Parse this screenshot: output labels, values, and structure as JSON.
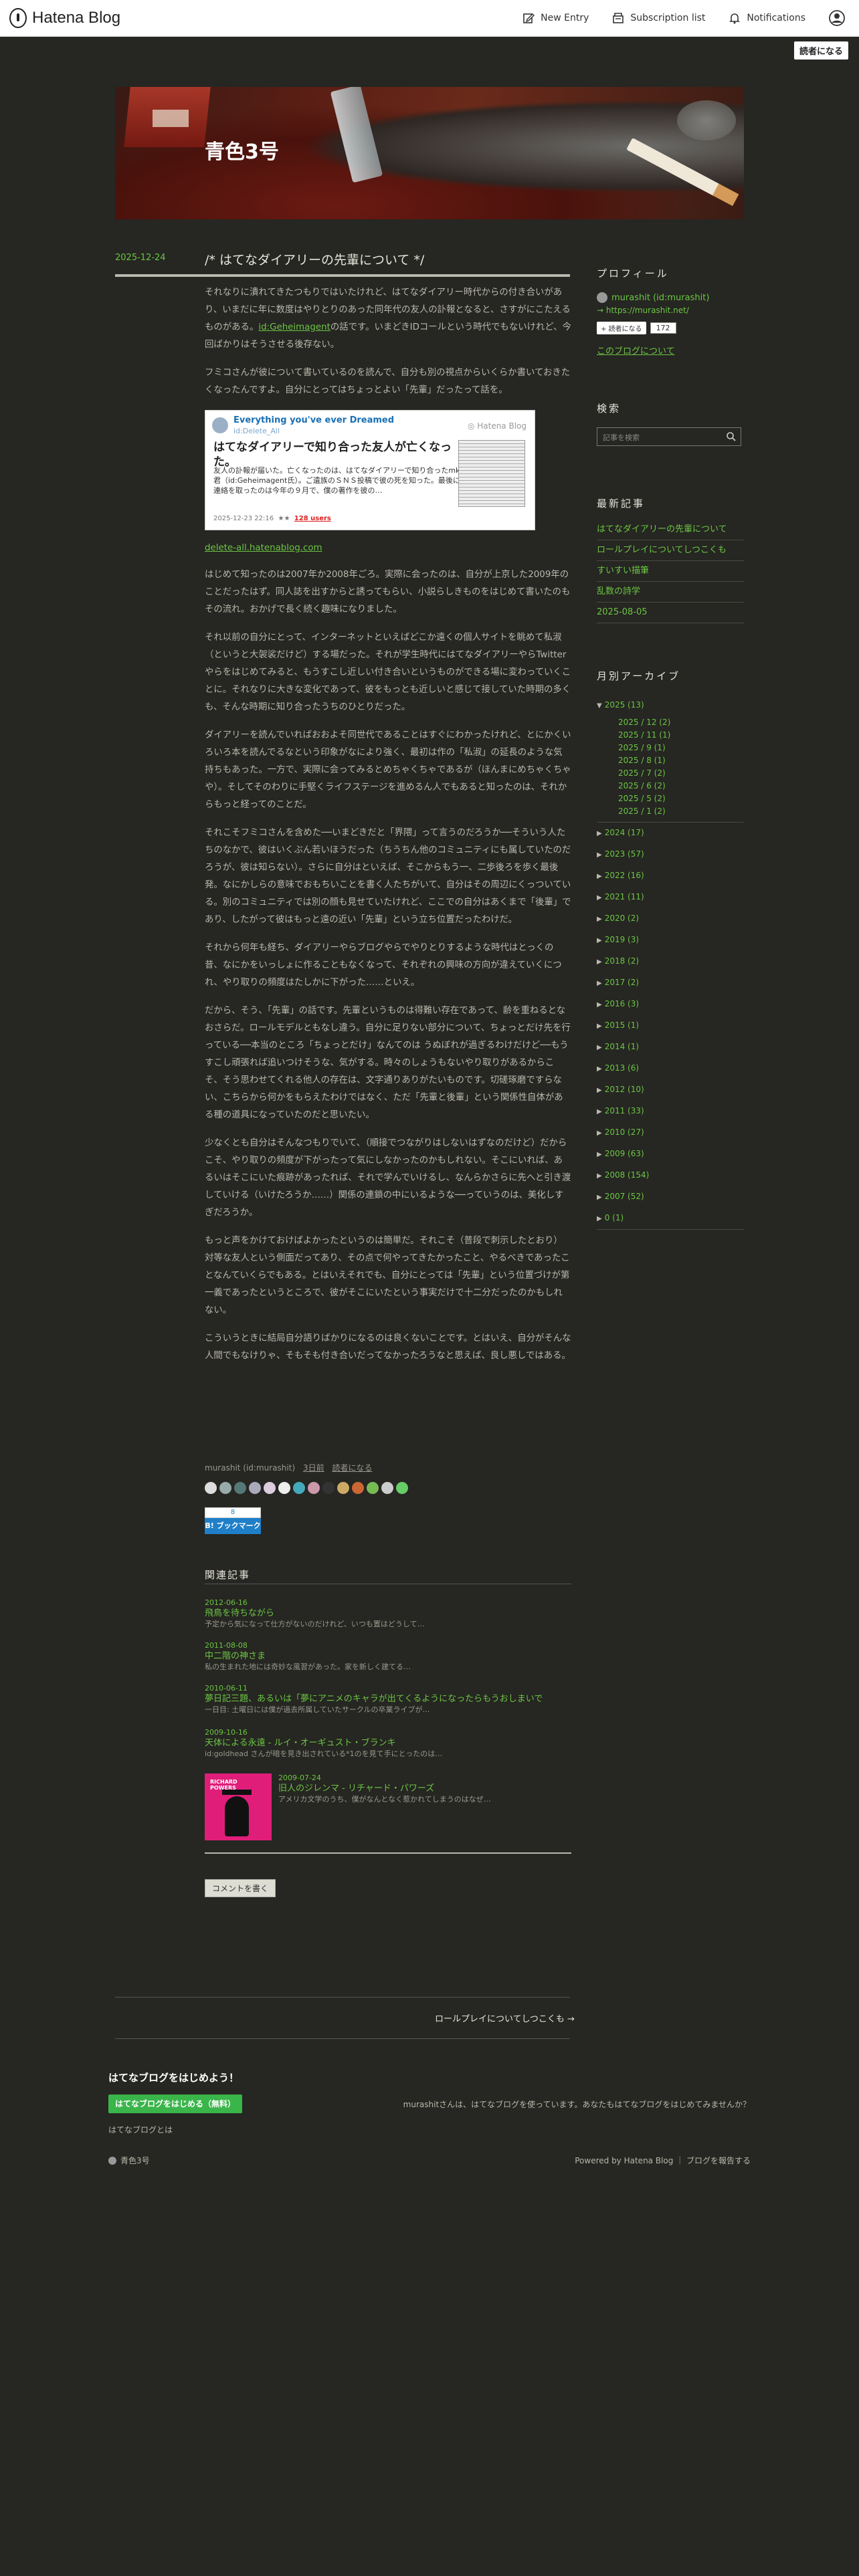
{
  "global_header": {
    "brand": "Hatena Blog",
    "new_entry": "New Entry",
    "subscription": "Subscription list",
    "notifications": "Notifications",
    "reader_button": "読者になる"
  },
  "blog": {
    "title": "青色3号"
  },
  "entry": {
    "date": "2025-12-24",
    "title": "/* はてなダイアリーの先輩について */",
    "paragraphs": [
      {
        "before": "それなりに潰れてきたつもりではいたけれど、はてなダイアリー時代からの付き合いがあり、いまだに年に数度はやりとりのあった同年代の友人の訃報となると、さすがにこたえるものがある。",
        "link": "id:Geheimagent",
        "after": "の話です。いまどきIDコールという時代でもないけれど、今回ばかりはそうさせる後存ない。"
      },
      {
        "before": "フミコさんが彼について書いているのを読んで、自分も別の視点からいくらか書いておきたくなったんですよ。自分にとってはちょっとよい「先輩」だったって話を。",
        "link": "",
        "after": ""
      }
    ],
    "embed": {
      "source": "Everything you've ever Dreamed",
      "source_id": "id:Delete_All",
      "brand": "Hatena Blog",
      "title": "はてなダイアリーで知り合った友人が亡くなった。",
      "excerpt": "友人の訃報が届いた。亡くなったのは、はてなダイアリーで知り合ったmk君（id:Geheimagent氏）。ご遺族のＳＮＳ投稿で彼の死を知った。最後に連絡を取ったのは今年の９月で、僕の著作を彼の…",
      "meta": "2025-12-23 22:16",
      "users": "128 users"
    },
    "embed_link": "delete-all.hatenablog.com",
    "paragraphs2": [
      "はじめて知ったのは2007年か2008年ごろ。実際に会ったのは、自分が上京した2009年のことだったはず。同人誌を出すからと誘ってもらい、小説らしきものをはじめて書いたのもその流れ。おかげで長く続く趣味になりました。",
      "それ以前の自分にとって、インターネットといえばどこか遠くの個人サイトを眺めて私淑（というと大袈裟だけど）する場だった。それが学生時代にはてなダイアリーやらTwitterやらをはじめてみると、もうすこし近しい付き合いというものができる場に変わっていくことに。それなりに大きな変化であって、彼をもっとも近しいと感じて接していた時期の多くも、そんな時期に知り合ったうちのひとりだった。",
      "ダイアリーを読んでいればおおよそ同世代であることはすぐにわかったけれど、とにかくいろいろ本を読んでるなという印象がなにより強く、最初は作の「私淑」の延長のような気持ちもあった。一方で、実際に会ってみるとめちゃくちゃであるが（ほんまにめちゃくちゃや）。そしてそのわりに手堅くライフステージを進めるん人でもあると知ったのは、それからもっと経ってのことだ。",
      "それこそフミコさんを含めた──いまどきだと「界隈」って言うのだろうか──そういう人たちのなかで、彼はいくぶん若いほうだった（ちうちん他のコミュニティにも属していたのだろうが、彼は知らない）。さらに自分はといえば、そこからもう一、二歩後ろを歩く最後発。なにかしらの意味でおもちいことを書く人たちがいて、自分はその周辺にくっついている。別のコミュニティでは別の顔も見せていたけれど、ここでの自分はあくまで「後輩」であり、したがって彼はもっと遠の近い「先輩」という立ち位置だったわけだ。",
      "それから何年も経ち、ダイアリーやらブログやらでやりとりするような時代はとっくの昔、なにかをいっしょに作ることもなくなって、それぞれの興味の方向が違えていくにつれ、やり取りの頻度はたしかに下がった……といえ。",
      "だから、そう、「先輩」の話です。先輩というものは得難い存在であって、齢を重ねるとなおさらだ。ロールモデルともなし違う。自分に足りない部分について、ちょっとだけ先を行っている──本当のところ「ちょっとだけ」なんてのは うぬぼれが過ぎるわけだけど──もうすこし頑張れば追いつけそうな、気がする。時々のしょうもないやり取りがあるからこそ、そう思わせてくれる他人の存在は、文字通りありがたいものです。切磋琢磨ですらない、こちらから何かをもらえたわけではなく、ただ「先輩と後輩」という関係性自体がある種の道具になっていたのだと思いたい。",
      "少なくとも自分はそんなつもりでいて、（順接でつながりはしないはずなのだけど）だからこそ、やり取りの頻度が下がったって気にしなかったのかもしれない。そこにいれば、あるいはそこにいた痕跡があったれば、それで学んでいけるし、なんらかさらに先へと引き渡していける（いけたろうか……）関係の連鎖の中にいるような──っていうのは、美化しすぎだろうか。",
      "もっと声をかけておけばよかったというのは簡単だ。それこそ（普段で刺示したとおり）対等な友人という側面だってあり、その点で何やってきたかったこと、やるべきであったことなんていくらでもある。とはいえそれでも、自分にとっては「先輩」という位置づけが第一義であったというところで、彼がそこにいたという事実だけで十二分だったのかもしれない。",
      "こういうときに結局自分語りばかりになるのは良くないことです。とはいえ、自分がそんな人間でもなけりゃ、そもそも付き合いだってなかったろうなと思えば、良し悪しではある。"
    ],
    "footer": {
      "author": "murashit (id:murashit)",
      "ago": "3日前",
      "reader": "読者になる"
    },
    "bookmark": {
      "count": "8",
      "label": "B! ブックマーク"
    }
  },
  "related": {
    "heading": "関連記事",
    "items": [
      {
        "date": "2012-06-16",
        "title": "飛鳥を待ちながら",
        "snippet": "予定から気になって仕方がないのだけれど、いつも置はどうして…"
      },
      {
        "date": "2011-08-08",
        "title": "中二階の神さま",
        "snippet": "私の生まれた地には奇妙な風習があった。家を新しく建てる…"
      },
      {
        "date": "2010-06-11",
        "title": "夢日記三題、あるいは「夢にアニメのキャラが出てくるようになったらもうおしまいで",
        "snippet": "一日目: 土曜日には僕が過去所属していたサークルの卒業ライブが…"
      },
      {
        "date": "2009-10-16",
        "title": "天体による永遠 - ルイ・オーギュスト・ブランキ",
        "snippet": "id:goldhead さんが暗を見き出されている*1のを見て手にとったのは…"
      },
      {
        "date": "2009-07-24",
        "title": "旧人のジレンマ - リチャード・パワーズ",
        "snippet": "アメリカ文学のうち、僕がなんとなく惹かれてしまうのはなぜ…"
      }
    ],
    "image_text": "RICHARD POWERS"
  },
  "comment_button": "コメントを書く",
  "pager_next": "ロールプレイについてしつこくも →",
  "sidebar": {
    "profile_h": "プロフィール",
    "profile_name": "murashit (id:murashit)",
    "profile_url": "→ https://murashit.net/",
    "reader_btn": "読者になる",
    "reader_count": "172",
    "about_blog": "このブログについて",
    "search_h": "検索",
    "search_placeholder": "記事を検索",
    "recent_h": "最新記事",
    "recent": [
      "はてなダイアリーの先輩について",
      "ロールプレイについてしつこくも",
      "すいすい描筆",
      "乱数の詩学",
      "2025-08-05"
    ],
    "archive_h": "月別アーカイブ",
    "archive_open": "2025 (13)",
    "archive_months": [
      "2025 / 12 (2)",
      "2025 / 11 (1)",
      "2025 / 9 (1)",
      "2025 / 8 (1)",
      "2025 / 7 (2)",
      "2025 / 6 (2)",
      "2025 / 5 (2)",
      "2025 / 1 (2)"
    ],
    "archive_years": [
      "2024 (17)",
      "2023 (57)",
      "2022 (16)",
      "2021 (11)",
      "2020 (2)",
      "2019 (3)",
      "2018 (2)",
      "2017 (2)",
      "2016 (3)",
      "2015 (1)",
      "2014 (1)",
      "2013 (6)",
      "2012 (10)",
      "2011 (33)",
      "2010 (27)",
      "2009 (63)",
      "2008 (154)",
      "2007 (52)",
      "0 (1)"
    ]
  },
  "footer": {
    "heading": "はてなブログをはじめよう！",
    "button": "はてなブログをはじめる（無料）",
    "about": "はてなブログとは",
    "message": "murashitさんは、はてなブログを使っています。あなたもはてなブログをはじめてみませんか？",
    "blog_name": "青色3号",
    "powered": "Powered by Hatena Blog ｜ ブログを報告する"
  }
}
